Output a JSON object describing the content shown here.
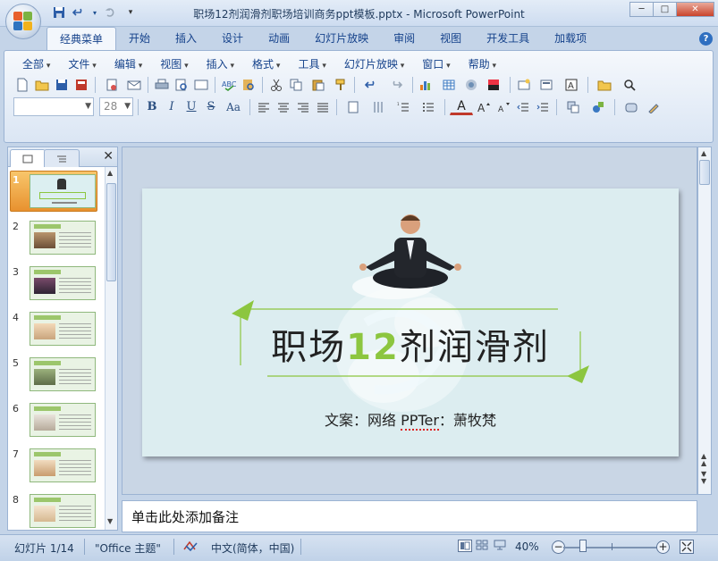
{
  "window": {
    "title": "职场12剂润滑剂职场培训商务ppt模板.pptx - Microsoft PowerPoint",
    "minimize": "─",
    "maximize": "□",
    "close": "✕"
  },
  "ribbon_tabs": [
    "经典菜单",
    "开始",
    "插入",
    "设计",
    "动画",
    "幻灯片放映",
    "审阅",
    "视图",
    "开发工具",
    "加载项"
  ],
  "help_label": "?",
  "menu": [
    "全部",
    "文件",
    "编辑",
    "视图",
    "插入",
    "格式",
    "工具",
    "幻灯片放映",
    "窗口",
    "帮助"
  ],
  "toolbar": {
    "font_name": "",
    "font_size": "28",
    "bold": "B",
    "italic": "I",
    "underline": "U",
    "strike": "S",
    "case": "Aa",
    "font_color": "A"
  },
  "thumbnails": [
    "1",
    "2",
    "3",
    "4",
    "5",
    "6",
    "7",
    "8"
  ],
  "slide": {
    "title_before": "职场",
    "title_number": "12",
    "title_after": "剂润滑剂",
    "subtitle_prefix": "文案：网络 ",
    "subtitle_ppter": "PPTer",
    "subtitle_suffix": "：萧牧梵"
  },
  "notes_placeholder": "单击此处添加备注",
  "status": {
    "slide_count": "幻灯片 1/14",
    "theme": "\"Office 主题\"",
    "language": "中文(简体，中国)",
    "zoom": "40%"
  },
  "colors": {
    "accent_green": "#8cc63f",
    "slide_bg": "#dcedf0",
    "selection_orange": "#e8912f"
  }
}
